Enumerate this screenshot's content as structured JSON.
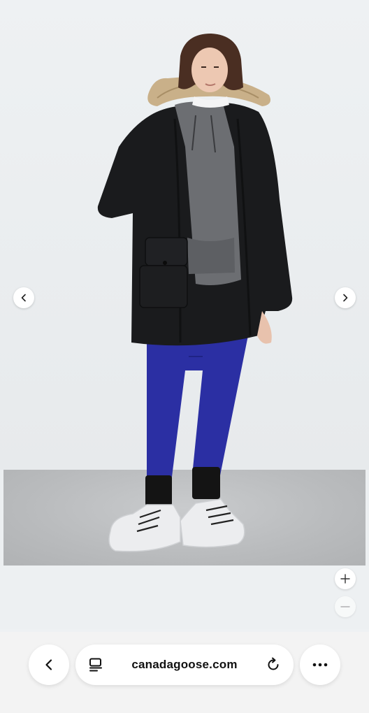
{
  "browser": {
    "url": "canadagoose.com"
  },
  "gallery": {
    "prev_icon": "chevron-left-icon",
    "next_icon": "chevron-right-icon",
    "zoom_in_icon": "plus-icon",
    "zoom_out_icon": "minus-icon"
  },
  "toolbar": {
    "back_icon": "chevron-left-icon",
    "tabs_icon": "page-menu-icon",
    "reload_icon": "reload-icon",
    "more_icon": "more-icon"
  },
  "colors": {
    "parka": "#1a1b1d",
    "hoodie": "#6c6e72",
    "leggings": "#2b2fa3",
    "fur": "#c9b089",
    "shoes": "#ecedef"
  }
}
